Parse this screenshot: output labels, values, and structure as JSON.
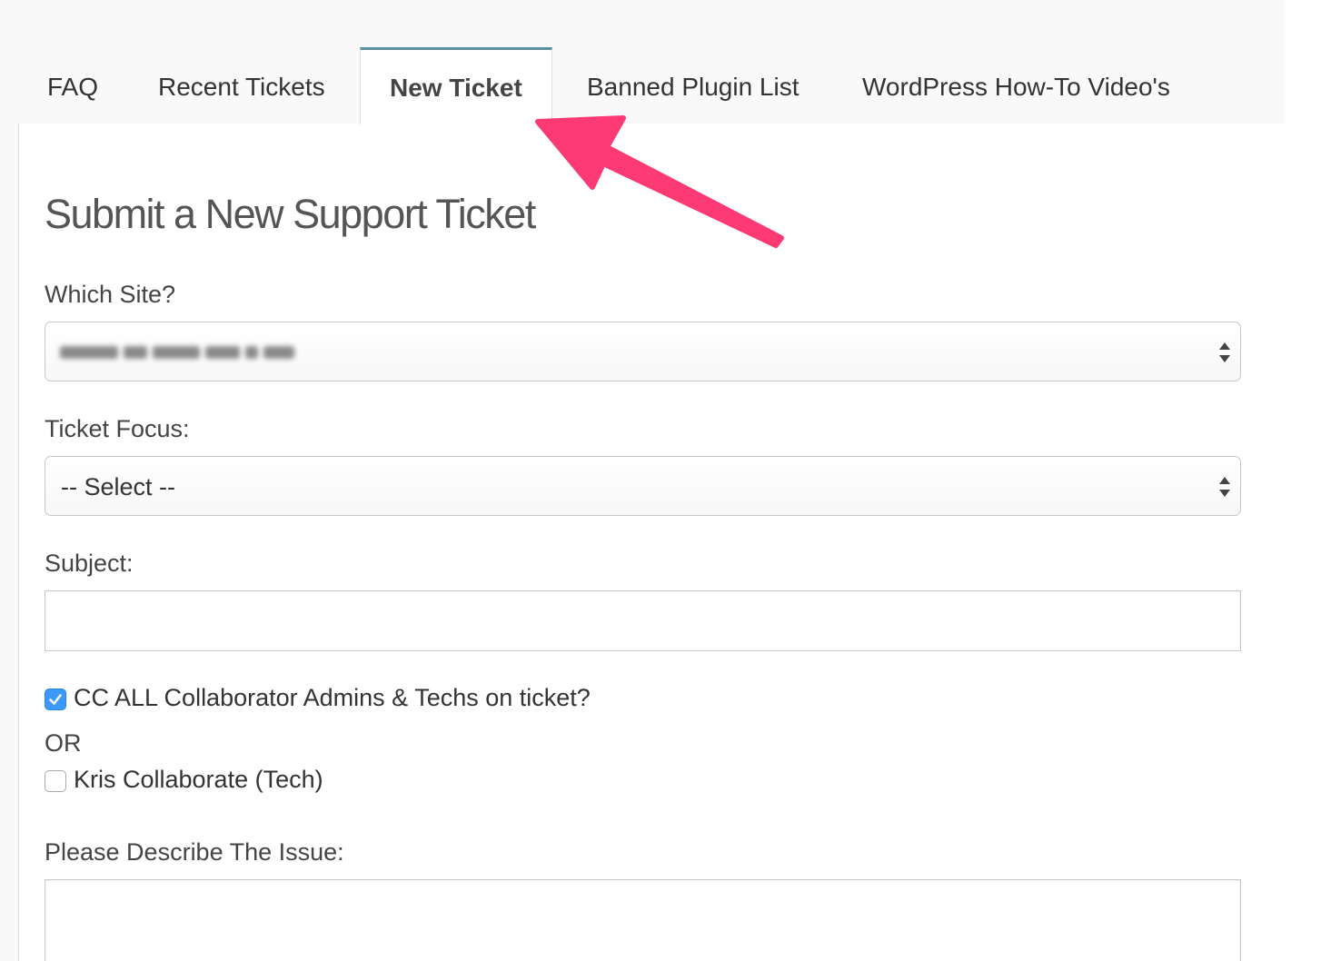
{
  "tabs": {
    "faq": "FAQ",
    "recent_tickets": "Recent Tickets",
    "new_ticket": "New Ticket",
    "banned_plugin_list": "Banned Plugin List",
    "how_to_videos": "WordPress How-To Video's",
    "active": "New Ticket"
  },
  "form": {
    "title": "Submit a New Support Ticket",
    "site_label": "Which Site?",
    "site_value_note": "blurred",
    "focus_label": "Ticket Focus:",
    "focus_value": "-- Select --",
    "subject_label": "Subject:",
    "subject_value": "",
    "cc_all_label": "CC ALL Collaborator Admins & Techs on ticket?",
    "cc_all_checked": true,
    "or_text": "OR",
    "collaborator_label": "Kris Collaborate (Tech)",
    "collaborator_checked": false,
    "describe_label": "Please Describe The Issue:",
    "describe_value": ""
  },
  "colors": {
    "accent_tab_border": "#5b8fa3",
    "annotation_arrow": "#fd3a73",
    "checkbox_checked": "#3b99fc"
  },
  "icons": {
    "select_arrows": "up-down-chevrons-icon",
    "checkmark": "check-icon",
    "annotation": "pointer-arrow-icon"
  }
}
